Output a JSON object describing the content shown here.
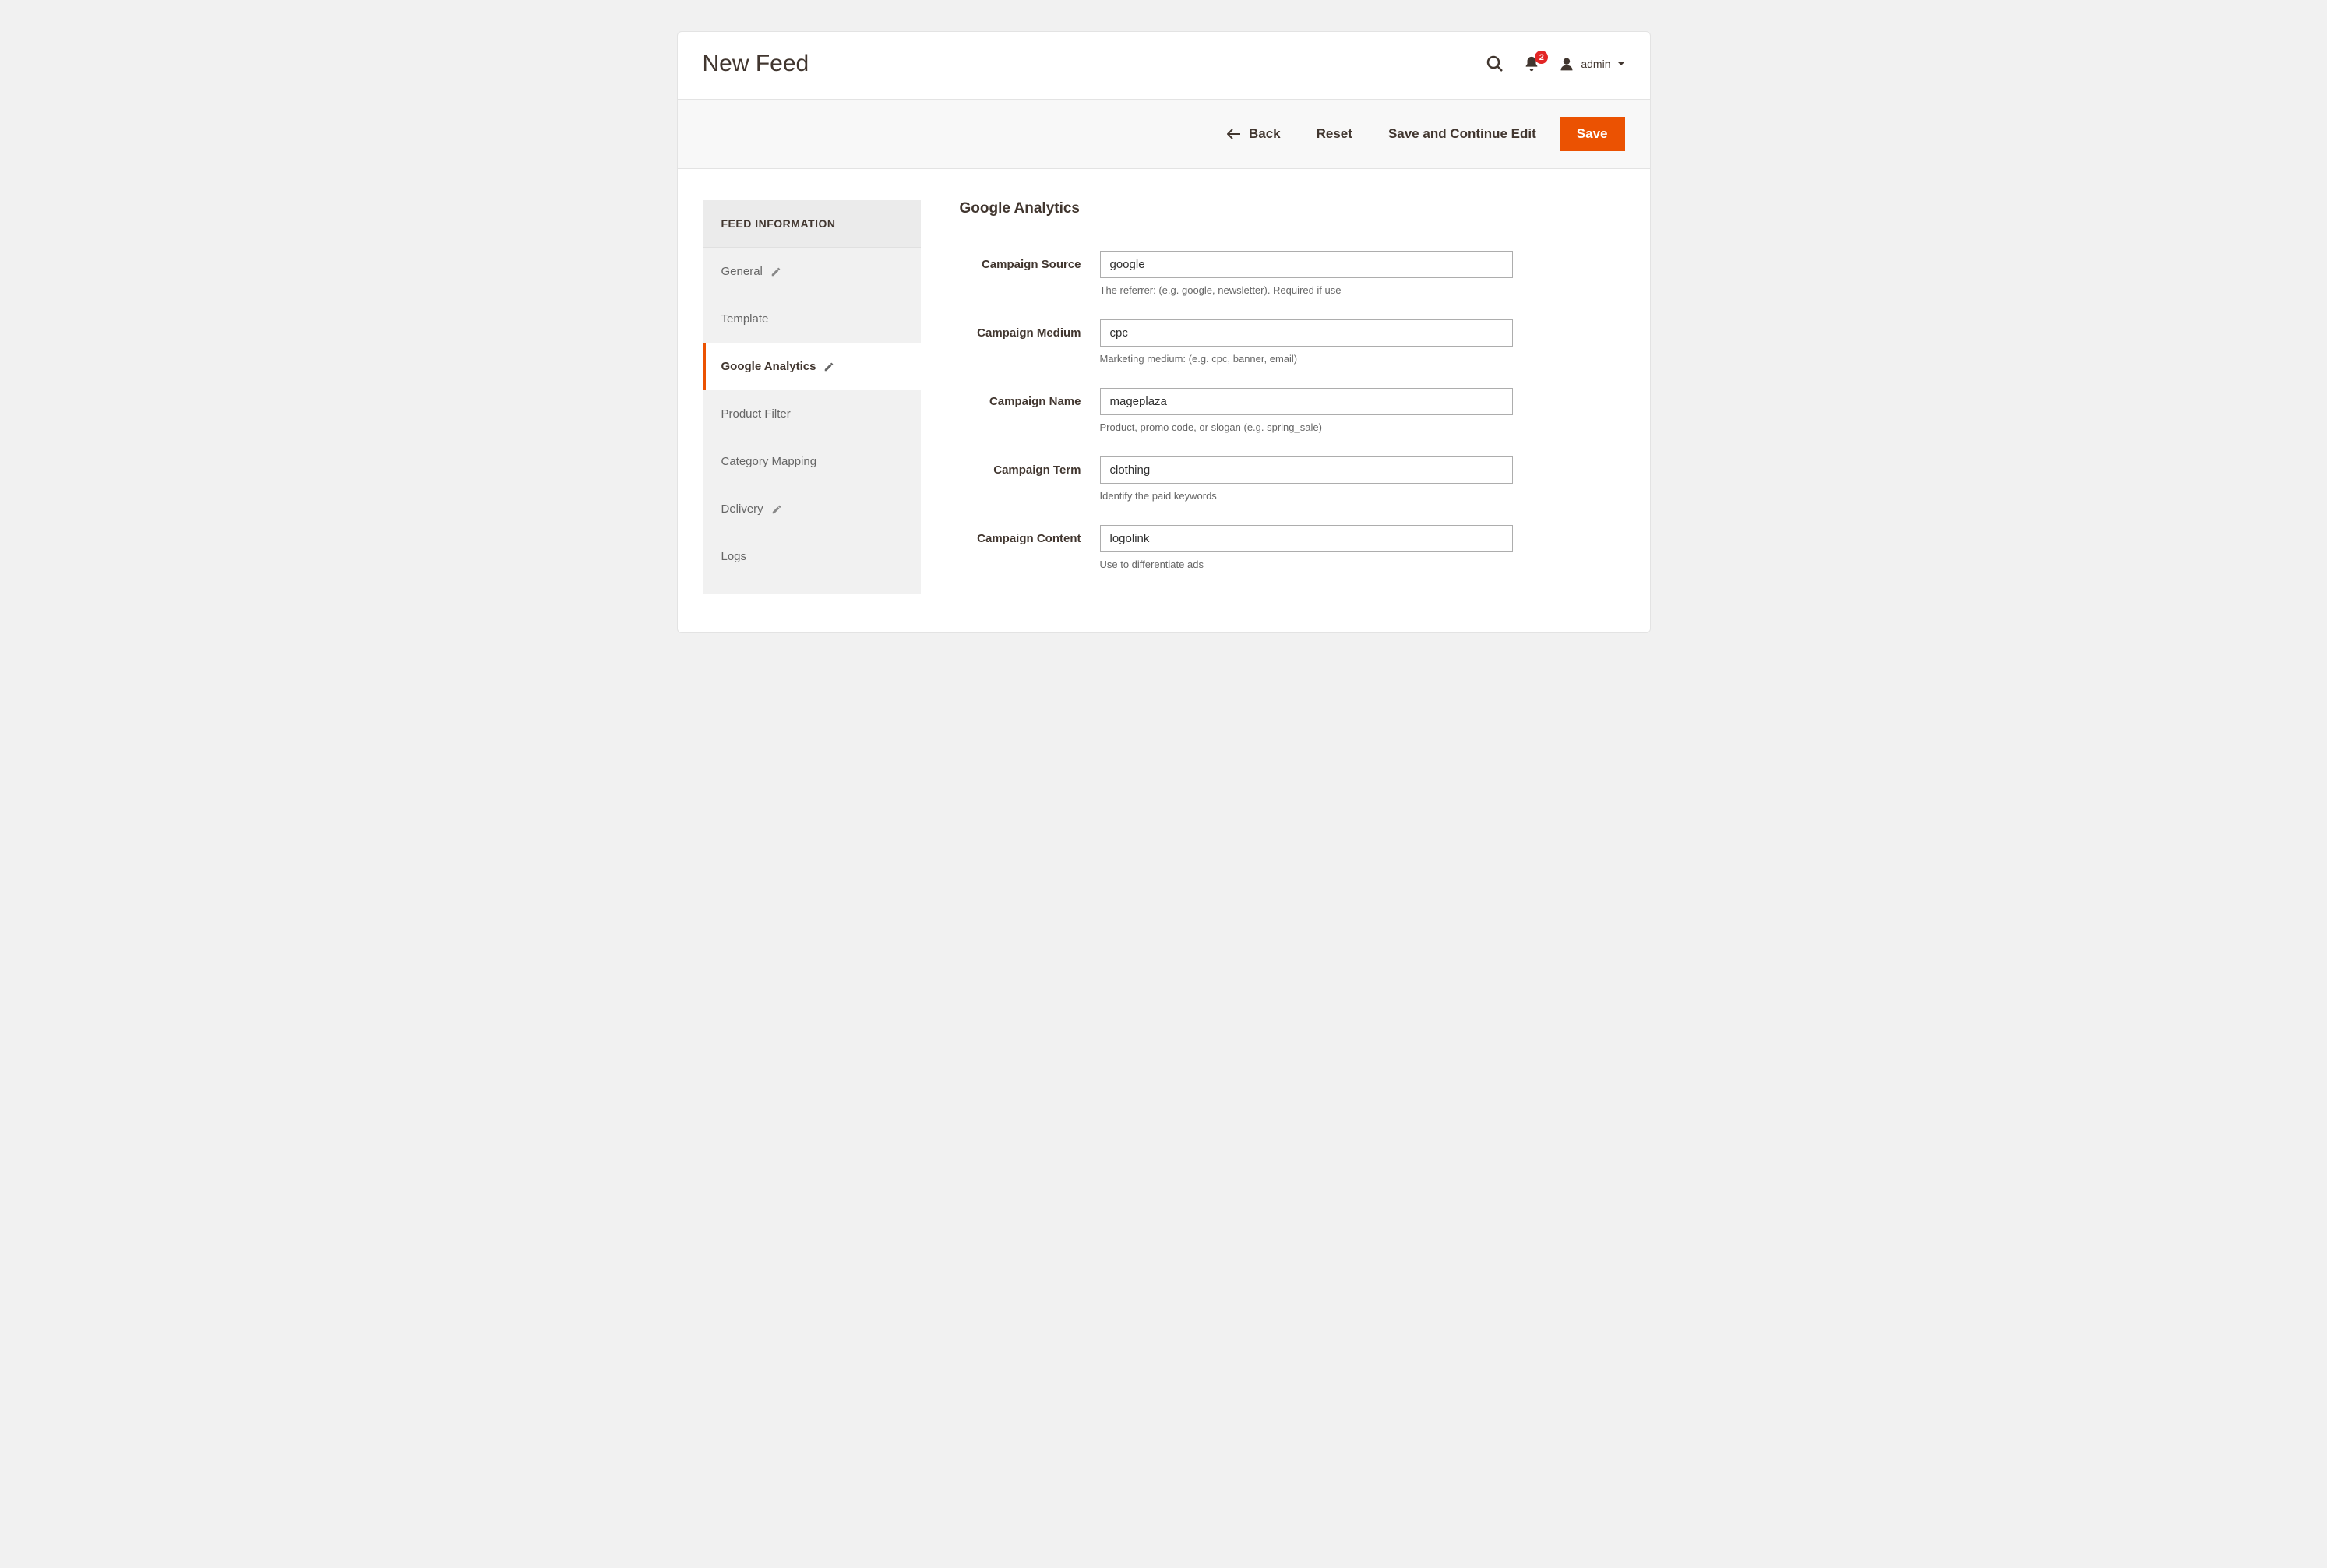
{
  "header": {
    "title": "New Feed",
    "notification_count": "2",
    "user_name": "admin"
  },
  "toolbar": {
    "back_label": "Back",
    "reset_label": "Reset",
    "save_continue_label": "Save and Continue Edit",
    "save_label": "Save"
  },
  "sidebar": {
    "title": "FEED INFORMATION",
    "items": [
      {
        "label": "General",
        "editable": true
      },
      {
        "label": "Template",
        "editable": false
      },
      {
        "label": "Google Analytics",
        "editable": true,
        "active": true
      },
      {
        "label": "Product Filter",
        "editable": false
      },
      {
        "label": "Category Mapping",
        "editable": false
      },
      {
        "label": "Delivery",
        "editable": true
      },
      {
        "label": "Logs",
        "editable": false
      }
    ]
  },
  "section": {
    "title": "Google Analytics",
    "fields": {
      "source": {
        "label": "Campaign Source",
        "value": "google",
        "hint": "The referrer: (e.g. google, newsletter). Required if use"
      },
      "medium": {
        "label": "Campaign Medium",
        "value": "cpc",
        "hint": "Marketing medium: (e.g. cpc, banner, email)"
      },
      "name": {
        "label": "Campaign Name",
        "value": "mageplaza",
        "hint": "Product, promo code, or slogan (e.g. spring_sale)"
      },
      "term": {
        "label": "Campaign Term",
        "value": "clothing",
        "hint": "Identify the paid keywords"
      },
      "content": {
        "label": "Campaign Content",
        "value": "logolink",
        "hint": "Use to differentiate ads"
      }
    }
  }
}
